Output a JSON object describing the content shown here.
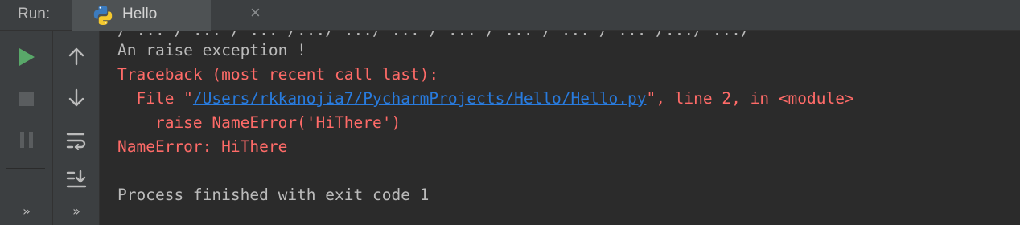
{
  "header": {
    "run_label": "Run:",
    "tab": {
      "title": "Hello",
      "close_glyph": "×",
      "icon": "python-icon"
    }
  },
  "gutter": {
    "left": [
      "run-icon",
      "stop-icon",
      "pause-icon"
    ],
    "right": [
      "scroll-up-icon",
      "scroll-down-icon",
      "soft-wrap-icon",
      "scroll-to-end-icon"
    ],
    "more_glyph": "»"
  },
  "console": {
    "cut_line": "/ ... / ... / ... /.../ .../ ... / ... / ... / ... / ... /.../ .../",
    "line1": "An raise exception !",
    "traceback": "Traceback (most recent call last):",
    "file_prefix": "  File \"",
    "file_link": "/Users/rkkanojia7/PycharmProjects/Hello/Hello.py",
    "file_suffix": "\", line 2, in <module>",
    "raise_line": "    raise NameError('HiThere')",
    "error_line": "NameError: HiThere",
    "process_line": "Process finished with exit code 1"
  },
  "colors": {
    "background": "#2b2b2b",
    "error": "#ff6b68",
    "link": "#287bde",
    "run_green": "#59a869"
  }
}
